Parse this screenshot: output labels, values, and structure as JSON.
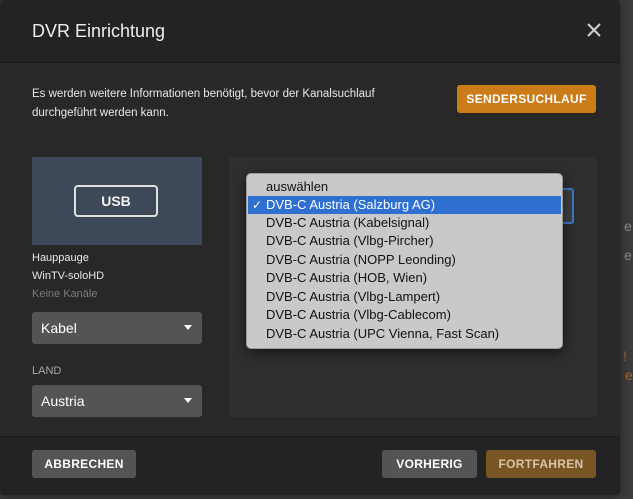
{
  "dialog": {
    "title": "DVR Einrichtung",
    "close_icon": "close-icon",
    "info_text": "Es werden weitere Informationen benötigt, bevor der Kanalsuchlauf durchgeführt werden kann.",
    "scan_button": "SENDERSUCHLAUF"
  },
  "device": {
    "usb_label": "USB",
    "brand": "Hauppauge",
    "model": "WinTV-soloHD",
    "channels": "Keine Kanäle",
    "signal_type": "Kabel",
    "country_label": "LAND",
    "country": "Austria"
  },
  "dropdown": {
    "check_glyph": "✓",
    "options": [
      "auswählen",
      "DVB-C Austria (Salzburg AG)",
      "DVB-C Austria (Kabelsignal)",
      "DVB-C Austria (Vlbg-Pircher)",
      "DVB-C Austria (NOPP Leonding)",
      "DVB-C Austria (HOB, Wien)",
      "DVB-C Austria (Vlbg-Lampert)",
      "DVB-C Austria (Vlbg-Cablecom)",
      "DVB-C Austria (UPC Vienna, Fast Scan)"
    ],
    "selected": "DVB-C Austria (Salzburg AG)"
  },
  "footer": {
    "cancel": "ABBRECHEN",
    "previous": "VORHERIG",
    "continue": "FORTFAHREN"
  },
  "background": {
    "fragments": [
      "e",
      "e",
      "!",
      "el"
    ]
  },
  "colors": {
    "accent": "#cc7b19",
    "selection": "#2f6fd0",
    "device_card": "#3d4858"
  }
}
